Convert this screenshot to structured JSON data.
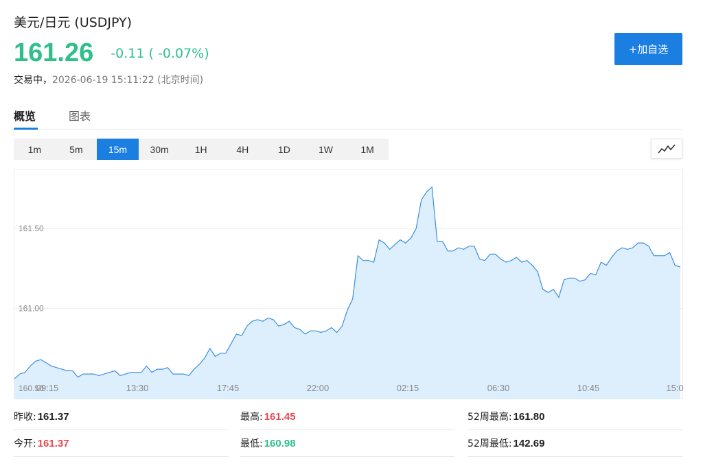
{
  "header": {
    "name": "美元/日元",
    "code": "(USDJPY)",
    "price": "161.26",
    "change": "-0.11 ( -0.07%)",
    "status": "交易中，",
    "timestamp": "2026-06-19 15:11:22 (北京时间)",
    "add_button": "+加自选"
  },
  "tabs": [
    "概览",
    "图表"
  ],
  "periods": [
    "1m",
    "5m",
    "15m",
    "30m",
    "1H",
    "4H",
    "1D",
    "1W",
    "1M"
  ],
  "active_period": "15m",
  "chart_type_icon": "line-chart-icon",
  "colors": {
    "up": "#e8484d",
    "down": "#2fbf8b",
    "accent": "#1a7fe0",
    "line": "#3b8ee0",
    "area": "#ddeefc"
  },
  "chart_data": {
    "type": "area",
    "x_labels": [
      "09:15",
      "13:30",
      "17:45",
      "22:00",
      "02:15",
      "06:30",
      "10:45",
      "15:0"
    ],
    "y_ticks": [
      "160.50",
      "161.00",
      "161.50"
    ],
    "ylim": [
      160.44,
      161.87
    ],
    "grid": true,
    "values": [
      160.56,
      160.59,
      160.6,
      160.64,
      160.67,
      160.68,
      160.66,
      160.64,
      160.63,
      160.62,
      160.61,
      160.61,
      160.57,
      160.59,
      160.59,
      160.59,
      160.58,
      160.59,
      160.6,
      160.61,
      160.58,
      160.59,
      160.6,
      160.6,
      160.6,
      160.64,
      160.6,
      160.62,
      160.62,
      160.63,
      160.59,
      160.59,
      160.59,
      160.58,
      160.62,
      160.65,
      160.69,
      160.75,
      160.7,
      160.72,
      160.72,
      160.78,
      160.84,
      160.83,
      160.89,
      160.92,
      160.93,
      160.92,
      160.94,
      160.93,
      160.89,
      160.9,
      160.92,
      160.88,
      160.87,
      160.84,
      160.86,
      160.86,
      160.85,
      160.86,
      160.88,
      160.85,
      160.89,
      160.99,
      161.06,
      161.33,
      161.3,
      161.3,
      161.29,
      161.43,
      161.41,
      161.37,
      161.4,
      161.43,
      161.41,
      161.44,
      161.5,
      161.68,
      161.73,
      161.76,
      161.42,
      161.42,
      161.36,
      161.36,
      161.38,
      161.37,
      161.39,
      161.39,
      161.31,
      161.3,
      161.34,
      161.34,
      161.31,
      161.29,
      161.3,
      161.32,
      161.29,
      161.3,
      161.27,
      161.23,
      161.12,
      161.1,
      161.12,
      161.07,
      161.18,
      161.19,
      161.19,
      161.17,
      161.18,
      161.22,
      161.21,
      161.29,
      161.27,
      161.32,
      161.36,
      161.38,
      161.37,
      161.38,
      161.41,
      161.41,
      161.39,
      161.33,
      161.33,
      161.33,
      161.35,
      161.27,
      161.26
    ]
  },
  "stats": [
    {
      "label": "昨收:",
      "value": "161.37",
      "tone": "dark"
    },
    {
      "label": "最高:",
      "value": "161.45",
      "tone": "red"
    },
    {
      "label": "52周最高:",
      "value": "161.80",
      "tone": "dark"
    },
    {
      "label": "今开:",
      "value": "161.37",
      "tone": "red"
    },
    {
      "label": "最低:",
      "value": "160.98",
      "tone": "green"
    },
    {
      "label": "52周最低:",
      "value": "142.69",
      "tone": "dark"
    }
  ]
}
